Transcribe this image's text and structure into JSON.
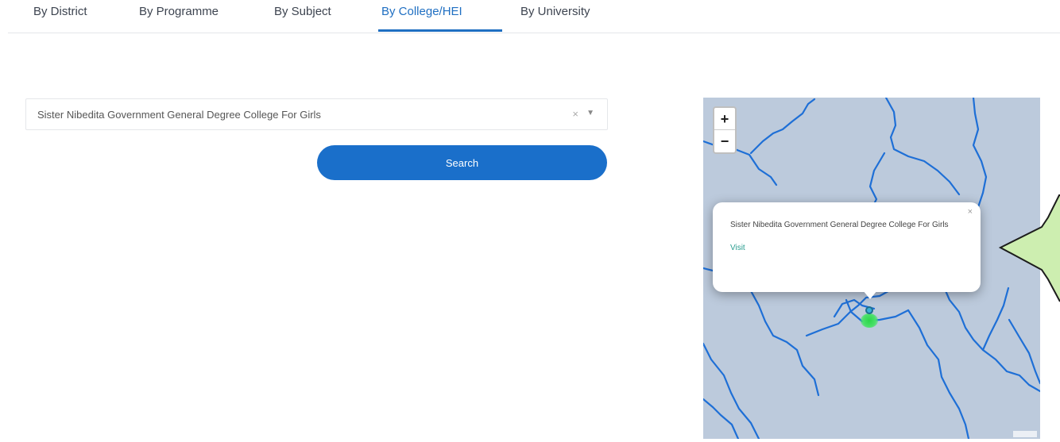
{
  "tabs": [
    {
      "label": "By District"
    },
    {
      "label": "By Programme"
    },
    {
      "label": "By Subject"
    },
    {
      "label": "By College/HEI"
    },
    {
      "label": "By University"
    }
  ],
  "active_tab": "By College/HEI",
  "select": {
    "value": "Sister Nibedita Government General Degree College For Girls",
    "clear_icon": "×",
    "caret_icon": "▼"
  },
  "search_button": {
    "label": "Search"
  },
  "map": {
    "zoom_in": "+",
    "zoom_out": "−",
    "water_color": "#bccadc",
    "river_color": "#1e6fd6",
    "marker_color": "#2bd64a"
  },
  "popup": {
    "title": "Sister Nibedita Government General Degree College For Girls",
    "link": "Visit",
    "close": "×"
  },
  "colors": {
    "accent": "#1a6fca",
    "callout": "#cdeeb0"
  }
}
